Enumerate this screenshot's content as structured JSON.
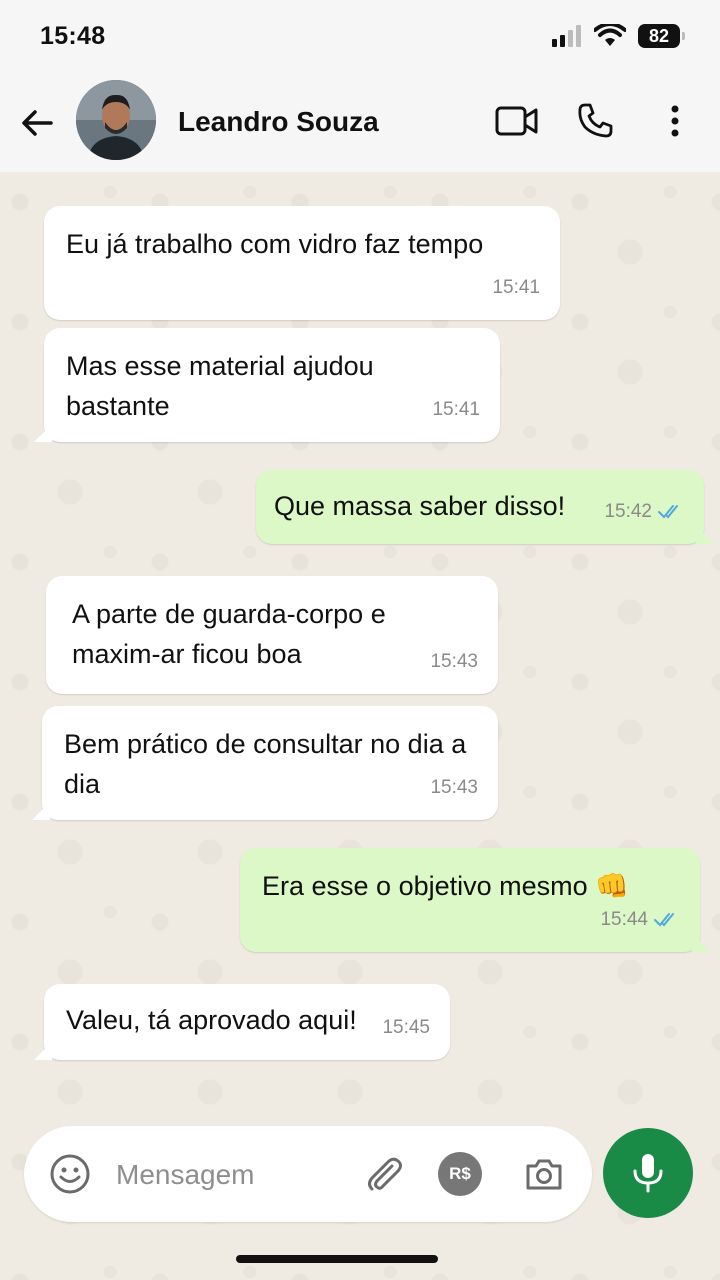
{
  "status": {
    "time": "15:48",
    "battery": "82"
  },
  "header": {
    "contact_name": "Leandro Souza"
  },
  "messages": [
    {
      "dir": "in",
      "text": "Eu já trabalho com vidro faz tempo",
      "time": "15:41"
    },
    {
      "dir": "in",
      "text": "Mas esse material ajudou bastante",
      "time": "15:41"
    },
    {
      "dir": "out",
      "text": "Que massa saber disso!",
      "time": "15:42",
      "read": true
    },
    {
      "dir": "in",
      "text": "A parte de guarda-corpo e maxim-ar ficou boa",
      "time": "15:43"
    },
    {
      "dir": "in",
      "text": "Bem prático de consultar no dia a dia",
      "time": "15:43"
    },
    {
      "dir": "out",
      "text": "Era esse o objetivo mesmo 👊",
      "time": "15:44",
      "read": true
    },
    {
      "dir": "in",
      "text": "Valeu, tá aprovado aqui!",
      "time": "15:45"
    }
  ],
  "composer": {
    "placeholder": "Mensagem",
    "pay_label": "R$"
  },
  "colors": {
    "incoming": "#ffffff",
    "outgoing": "#dcf8c6",
    "accent": "#1a8a47",
    "read_ticks": "#4fa8e0"
  },
  "icons": [
    "back-arrow-icon",
    "video-call-icon",
    "phone-icon",
    "more-options-icon",
    "emoji-icon",
    "paperclip-icon",
    "camera-icon",
    "microphone-icon",
    "double-check-icon"
  ]
}
